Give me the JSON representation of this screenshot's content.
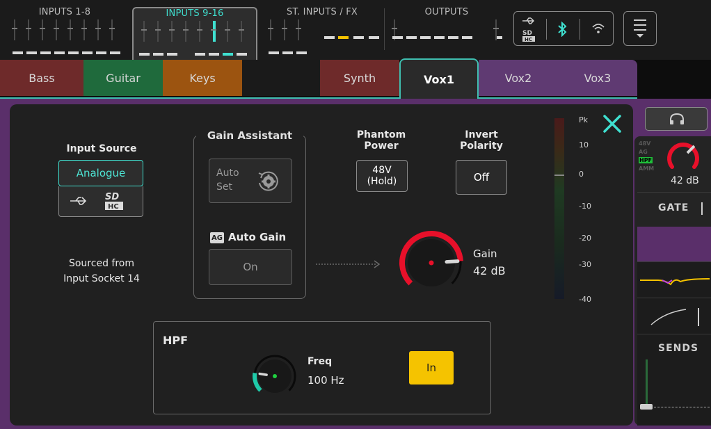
{
  "banks": [
    {
      "label": "INPUTS 1-8",
      "selected": false
    },
    {
      "label": "INPUTS 9-16",
      "selected": true
    },
    {
      "label": "ST. INPUTS / FX",
      "selected": false
    },
    {
      "label": "OUTPUTS",
      "selected": false
    }
  ],
  "status_icons": [
    "usb-icon",
    "sd-card-icon",
    "bluetooth-icon",
    "wifi-icon"
  ],
  "tabs": [
    {
      "label": "Bass",
      "color": "#6e2a2a"
    },
    {
      "label": "Guitar",
      "color": "#1f6a3c"
    },
    {
      "label": "Keys",
      "color": "#9c5410"
    },
    {
      "label": "",
      "color": "#1a1a1a"
    },
    {
      "label": "Synth",
      "color": "#6e2a2a"
    },
    {
      "label": "Vox1",
      "color": "#2a2a2a",
      "selected": true
    },
    {
      "label": "Vox2",
      "color": "#5f3a72"
    },
    {
      "label": "Vox3",
      "color": "#5f3a72"
    }
  ],
  "input_source": {
    "title": "Input Source",
    "selected": "Analogue",
    "options_icons": [
      "usb-icon",
      "sd-card-icon"
    ],
    "sourced_line1": "Sourced from",
    "sourced_line2": "Input Socket 14"
  },
  "gain_assistant": {
    "title": "Gain Assistant",
    "auto_set_line1": "Auto",
    "auto_set_line2": "Set",
    "auto_gain_badge": "AG",
    "auto_gain_label": "Auto Gain",
    "auto_gain_button": "On"
  },
  "phantom": {
    "title_line1": "Phantom",
    "title_line2": "Power",
    "button_line1": "48V",
    "button_line2": "(Hold)"
  },
  "polarity": {
    "title_line1": "Invert",
    "title_line2": "Polarity",
    "button": "Off"
  },
  "gain": {
    "label": "Gain",
    "value": "42 dB",
    "level": 0.82
  },
  "meter": {
    "scale": [
      "Pk",
      "10",
      "0",
      "-10",
      "-20",
      "-30",
      "-40"
    ]
  },
  "hpf": {
    "title": "HPF",
    "freq_label": "Freq",
    "freq_value": "100 Hz",
    "button": "In",
    "level": 0.2
  },
  "side": {
    "badges": [
      "48V",
      "AG",
      "HPF",
      "AMM"
    ],
    "gain_value": "42 dB",
    "gate_label": "GATE",
    "sends_label": "SENDS"
  },
  "colors": {
    "accent": "#3fe0d0",
    "gain_red": "#e8102a",
    "hpf_teal": "#1fc9a8",
    "in_yellow": "#f5c300"
  }
}
